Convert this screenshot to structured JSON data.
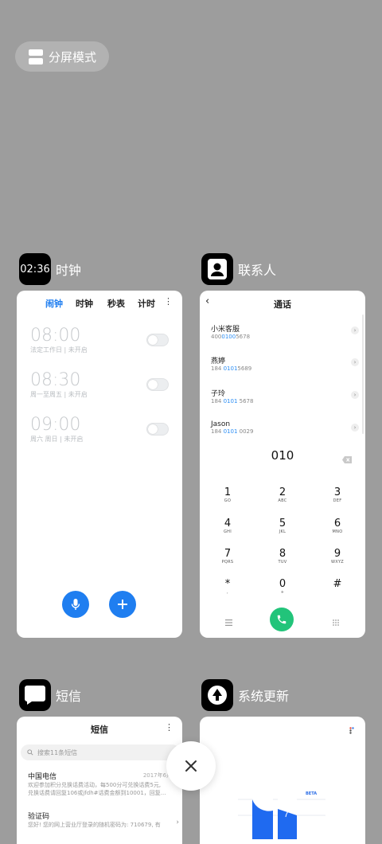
{
  "split_mode": {
    "label": "分屏模式"
  },
  "apps": {
    "clock": {
      "label": "时钟",
      "icon_time": "02:36",
      "tabs": [
        "闹钟",
        "时钟",
        "秒表",
        "计时"
      ],
      "alarms": [
        {
          "time": "08:00",
          "sub": "法定工作日 | 未开启"
        },
        {
          "time": "08:30",
          "sub": "周一至周五 | 未开启"
        },
        {
          "time": "09:00",
          "sub": "周六 周日 | 未开启"
        }
      ]
    },
    "contacts": {
      "label": "联系人",
      "title": "通话",
      "contacts": [
        {
          "name": "小米客服",
          "num_pre": "400",
          "num_hl": "0100",
          "num_post": "5678"
        },
        {
          "name": "燕婷",
          "num_pre": "184 ",
          "num_hl": "0101",
          "num_post": "5689"
        },
        {
          "name": "子玲",
          "num_pre": "184 ",
          "num_hl": "0101",
          "num_post": " 5678"
        },
        {
          "name": "Jason",
          "num_pre": "184 ",
          "num_hl": "0101",
          "num_post": " 0029"
        }
      ],
      "dial_input": "010",
      "keys": [
        {
          "d": "1",
          "l": "GO"
        },
        {
          "d": "2",
          "l": "ABC"
        },
        {
          "d": "3",
          "l": "DEF"
        },
        {
          "d": "4",
          "l": "GHI"
        },
        {
          "d": "5",
          "l": "JKL"
        },
        {
          "d": "6",
          "l": "MNO"
        },
        {
          "d": "7",
          "l": "PQRS"
        },
        {
          "d": "8",
          "l": "TUV"
        },
        {
          "d": "9",
          "l": "WXYZ"
        },
        {
          "d": "*",
          "l": ","
        },
        {
          "d": "0",
          "l": "+"
        },
        {
          "d": "#",
          "l": ""
        }
      ]
    },
    "sms": {
      "label": "短信",
      "title": "短信",
      "search_placeholder": "搜索11条短信",
      "messages": [
        {
          "sender": "中国电信",
          "date": "2017年6月30",
          "line1": "欢迎参加积分兑换话费活动，每500分可兑换话费5元,",
          "line2": "兑换话费请回复106或jfdh#话费金额到10001，回复..."
        },
        {
          "sender": "验证码",
          "date": "",
          "line1": "您好! 您的网上营业厅登录的随机密码为: 710679, 有",
          "line2": ""
        }
      ]
    },
    "update": {
      "label": "系统更新",
      "beta": "BETA"
    }
  },
  "colors": {
    "background": "#9d9d9d",
    "accent_blue": "#1f7ef0",
    "call_green": "#22c47a"
  }
}
